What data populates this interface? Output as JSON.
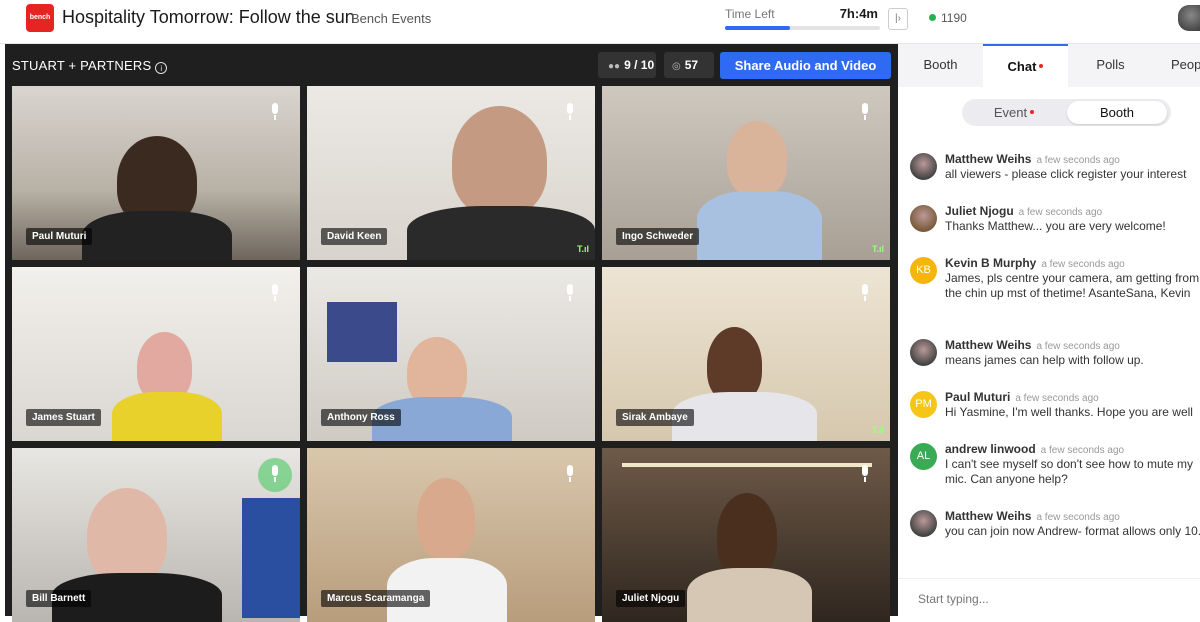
{
  "header": {
    "logo_text": "bench",
    "title": "Hospitality Tomorrow: Follow the sun",
    "organizer": "Bench Events",
    "time_left_label": "Time Left",
    "time_left_value": "7h:4m",
    "time_progress": 0.42,
    "collapse_icon": "collapse-icon",
    "online_count": "1190"
  },
  "booth": {
    "name": "STUART + PARTNERS",
    "seats": "9 / 10",
    "viewers": "57",
    "share_button": "Share Audio and Video"
  },
  "participants": [
    {
      "name": "Paul Muturi"
    },
    {
      "name": "David Keen"
    },
    {
      "name": "Ingo Schweder"
    },
    {
      "name": "James Stuart"
    },
    {
      "name": "Anthony Ross"
    },
    {
      "name": "Sirak Ambaye"
    },
    {
      "name": "Bill Barnett"
    },
    {
      "name": "Marcus Scaramanga"
    },
    {
      "name": "Juliet Njogu"
    }
  ],
  "panel": {
    "tabs": [
      "Booth",
      "Chat",
      "Polls",
      "Peop"
    ],
    "active_tab": "Chat",
    "chat_scopes": [
      "Event",
      "Booth"
    ],
    "active_scope": "Booth",
    "composer_placeholder": "Start typing..."
  },
  "messages": [
    {
      "author": "Matthew Weihs",
      "when": "a few seconds ago",
      "text": "all viewers - please click register your interest",
      "avatar": "photo",
      "color": "#444444"
    },
    {
      "author": "Juliet Njogu",
      "when": "a few seconds ago",
      "text": "Thanks Matthew... you are very welcome!",
      "avatar": "photo",
      "color": "#7a5a3a"
    },
    {
      "author": "Kevin B Murphy",
      "when": "a few seconds ago",
      "text": "James, pls centre your camera, am getting from the chin up mst of thetime! AsanteSana, Kevin",
      "avatar": "KB",
      "color": "#f5b50a"
    },
    {
      "author": "Matthew Weihs",
      "when": "a few seconds ago",
      "text": "means james can help with follow up.",
      "avatar": "photo",
      "color": "#444444"
    },
    {
      "author": "Paul Muturi",
      "when": "a few seconds ago",
      "text": "Hi Yasmine, I'm well thanks. Hope you are well",
      "avatar": "PM",
      "color": "#f5c518"
    },
    {
      "author": "andrew linwood",
      "when": "a few seconds ago",
      "text": "I can't see myself so don't see how to mute my mic. Can anyone help?",
      "avatar": "AL",
      "color": "#3aab55"
    },
    {
      "author": "Matthew Weihs",
      "when": "a few seconds ago",
      "text": "you can join now Andrew- format allows only 10.",
      "avatar": "photo",
      "color": "#444444"
    }
  ]
}
